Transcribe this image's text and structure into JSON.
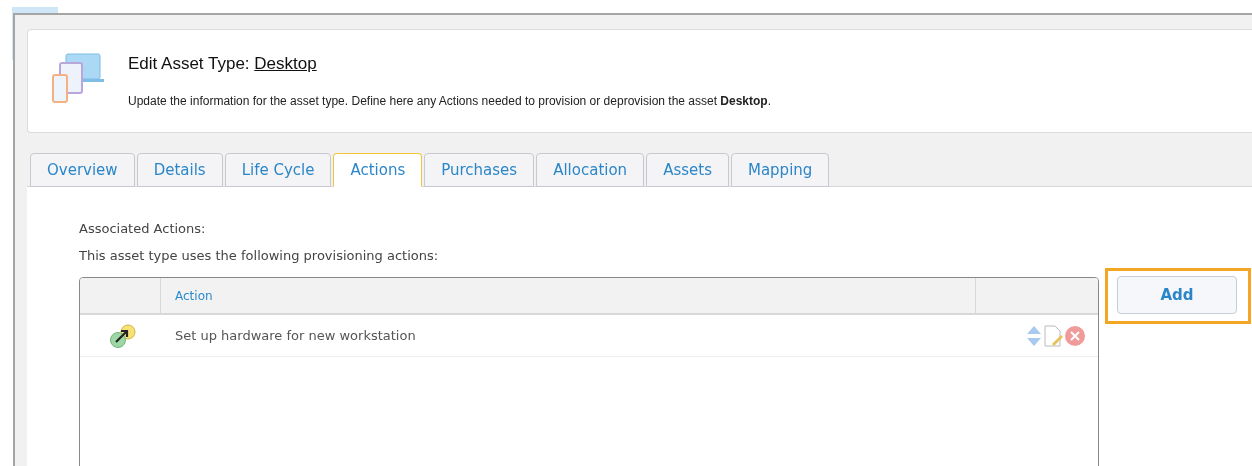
{
  "header": {
    "title": "Edit Asset Type: ",
    "title_link": "Desktop",
    "description": "Update the information for the asset type. Define here any Actions needed to provision or deprovision the asset **Desktop**."
  },
  "tabs": [
    {
      "label": "Overview",
      "selected": false
    },
    {
      "label": "Details",
      "selected": false
    },
    {
      "label": "Life Cycle",
      "selected": false
    },
    {
      "label": "Actions",
      "selected": true
    },
    {
      "label": "Purchases",
      "selected": false
    },
    {
      "label": "Allocation",
      "selected": false
    },
    {
      "label": "Assets",
      "selected": false
    },
    {
      "label": "Mapping",
      "selected": false
    }
  ],
  "section_title": "Associated Actions:",
  "section_text": "This asset type uses the following provisioning actions:",
  "table": {
    "columns": [
      "Action"
    ],
    "rows": [
      {
        "action": "Set up hardware for new workstation"
      }
    ]
  },
  "add_button": {
    "label": "Add",
    "highlighted": true
  }
}
